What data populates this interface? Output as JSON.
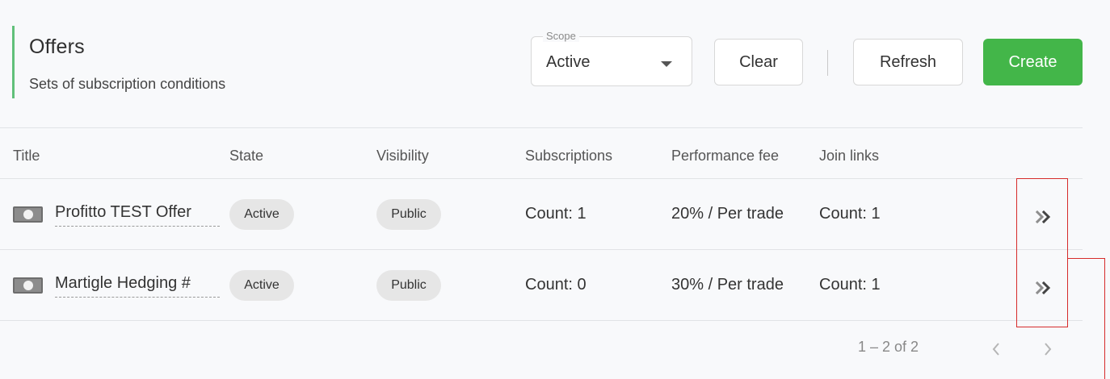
{
  "header": {
    "title": "Offers",
    "subtitle": "Sets of subscription conditions"
  },
  "toolbar": {
    "scope_label": "Scope",
    "scope_value": "Active",
    "clear_label": "Clear",
    "refresh_label": "Refresh",
    "create_label": "Create"
  },
  "table": {
    "columns": [
      "Title",
      "State",
      "Visibility",
      "Subscriptions",
      "Performance fee",
      "Join links"
    ],
    "rows": [
      {
        "title": "Profitto TEST Offer",
        "state": "Active",
        "visibility": "Public",
        "subscriptions": "Count: 1",
        "performance_fee": "20% / Per trade",
        "join_links": "Count: 1"
      },
      {
        "title": "Martigle Hedging #",
        "state": "Active",
        "visibility": "Public",
        "subscriptions": "Count: 0",
        "performance_fee": "30% / Per trade",
        "join_links": "Count: 1"
      }
    ]
  },
  "pagination": {
    "range_label": "1 – 2 of 2"
  },
  "colors": {
    "accent": "#61c07a",
    "create_button": "#43b649",
    "annotation": "#d62b2b",
    "chip_bg": "#e6e6e6"
  },
  "icons": {
    "offer": "banknote-icon",
    "row_open": "double-chevron-right-icon",
    "prev_page": "chevron-left-icon",
    "next_page": "chevron-right-icon",
    "select_caret": "caret-down-icon"
  }
}
